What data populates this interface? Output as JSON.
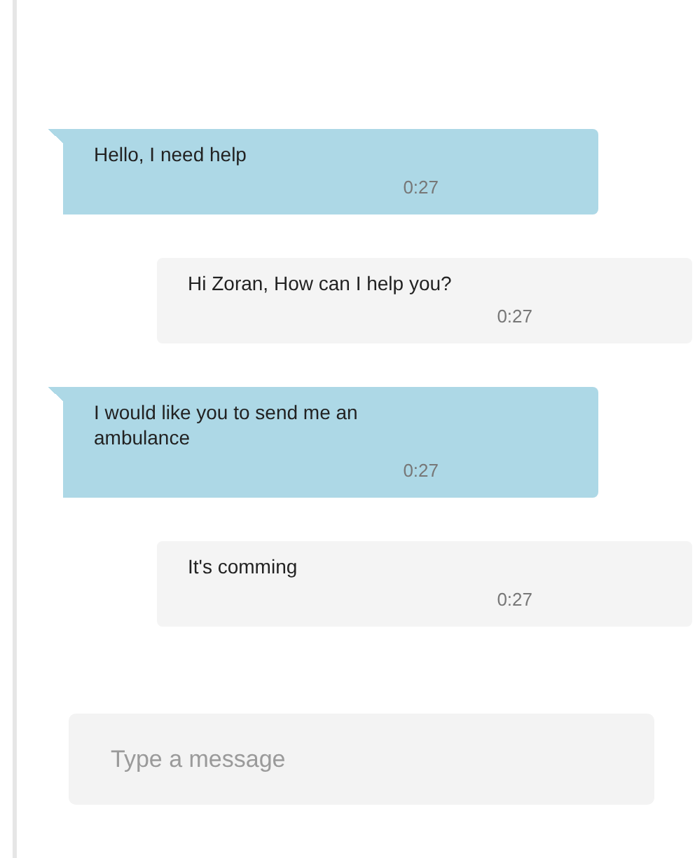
{
  "messages": [
    {
      "kind": "sent",
      "text": "Hello, I need help",
      "time": "0:27"
    },
    {
      "kind": "received",
      "text": "Hi Zoran, How can I help you?",
      "time": "0:27"
    },
    {
      "kind": "sent",
      "text": "I would like you to send me an ambulance",
      "time": "0:27"
    },
    {
      "kind": "received",
      "text": "It's comming",
      "time": "0:27"
    }
  ],
  "composer": {
    "placeholder": "Type a message"
  }
}
